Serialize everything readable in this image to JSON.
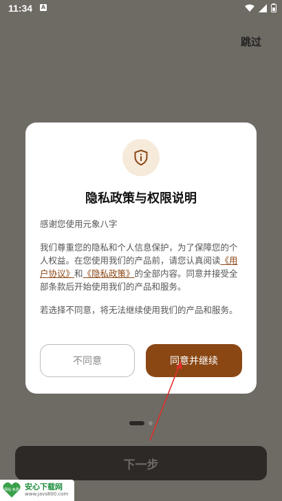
{
  "status": {
    "time": "11:34",
    "notification_letter": "A"
  },
  "top": {
    "skip_label": "跳过"
  },
  "dialog": {
    "title": "隐私政策与权限说明",
    "greeting": "感谢您使用元象八字",
    "body_prefix": "我们尊重您的隐私和个人信息保护，为了保障您的个人权益。在您使用我们的产品前，请您认真阅读",
    "link_user_agreement": "《用户协议》",
    "body_and": "和",
    "link_privacy_policy": "《隐私政策》",
    "body_suffix": "的全部内容。同意并接受全部条款后开始使用我们的产品和服务。",
    "disagree_note": "若选择不同意，将无法继续使用我们的产品和服务。",
    "decline_label": "不同意",
    "agree_label": "同意并继续"
  },
  "bottom": {
    "next_label": "下一步"
  },
  "watermark": {
    "title": "安心下载网",
    "url": "www.javs800.com",
    "logo_text": "网站 免费"
  },
  "colors": {
    "accent": "#8a4714",
    "overlay": "#6e6a64",
    "icon_bg": "#f6eadb",
    "annotation_arrow": "#e0302a"
  }
}
